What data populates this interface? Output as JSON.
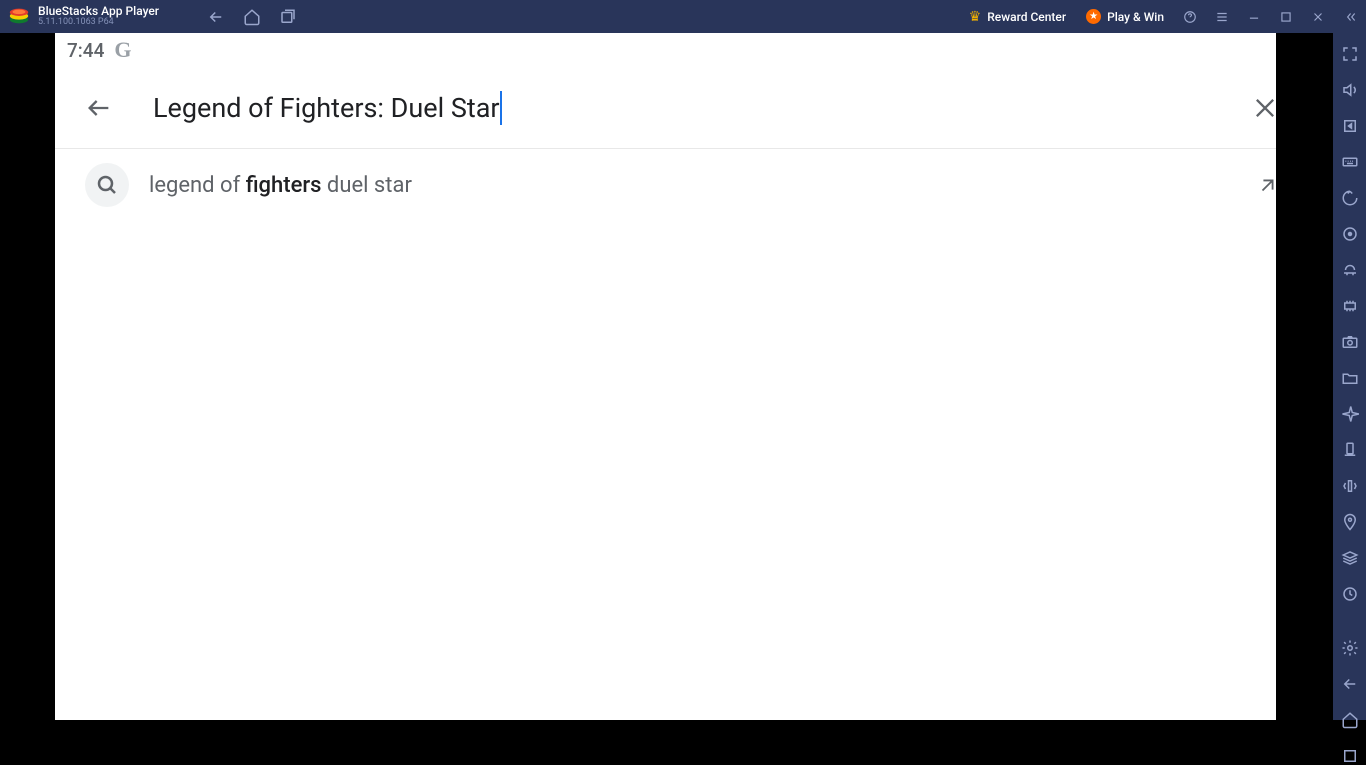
{
  "titlebar": {
    "app_name": "BlueStacks App Player",
    "version_line": "5.11.100.1063  P64",
    "reward_label": "Reward Center",
    "play_label": "Play & Win"
  },
  "statusbar": {
    "time": "7:44",
    "g_label": "G"
  },
  "search": {
    "value": "Legend of Fighters: Duel Star"
  },
  "suggestion": {
    "prefix": "legend of ",
    "bold": "fighters",
    "suffix": " duel star"
  },
  "side_icons": {
    "fullscreen": "fullscreen",
    "volume": "volume",
    "screenshot": "screenshot",
    "keyboard": "keyboard",
    "history": "history",
    "sync": "sync",
    "controller": "controller",
    "rec": "rec",
    "capture": "capture",
    "folder": "folder",
    "airplane": "airplane",
    "rotate": "rotate",
    "shake": "shake",
    "location": "location",
    "layers": "layers",
    "perf": "perf",
    "settings": "settings",
    "back": "back",
    "home": "home",
    "recent": "recent"
  }
}
